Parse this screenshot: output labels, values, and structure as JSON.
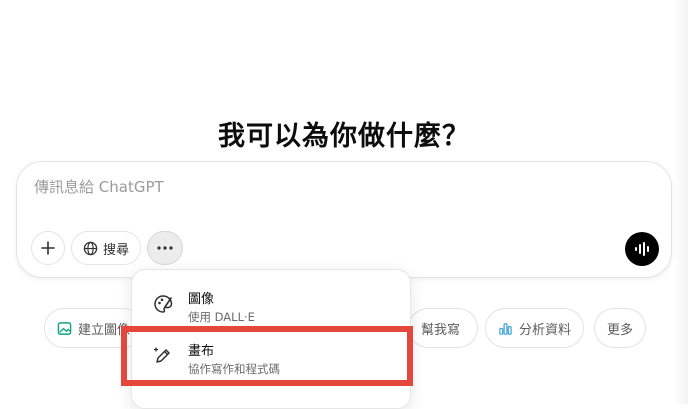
{
  "heading": "我可以為你做什麼？",
  "composer": {
    "placeholder": "傳訊息給 ChatGPT",
    "search_label": "搜尋"
  },
  "suggestions": {
    "create_image": "建立圖像",
    "help_write": "幫我寫",
    "analyze_data": "分析資料",
    "more": "更多"
  },
  "menu": {
    "items": [
      {
        "title": "圖像",
        "subtitle": "使用 DALL·E",
        "icon": "image-palette-icon"
      },
      {
        "title": "畫布",
        "subtitle": "協作寫作和程式碼",
        "icon": "canvas-pen-icon"
      }
    ]
  },
  "colors": {
    "highlight": "#e5473c",
    "create_image_icon": "#10a37f",
    "analyze_icon": "#4aa8e0"
  }
}
